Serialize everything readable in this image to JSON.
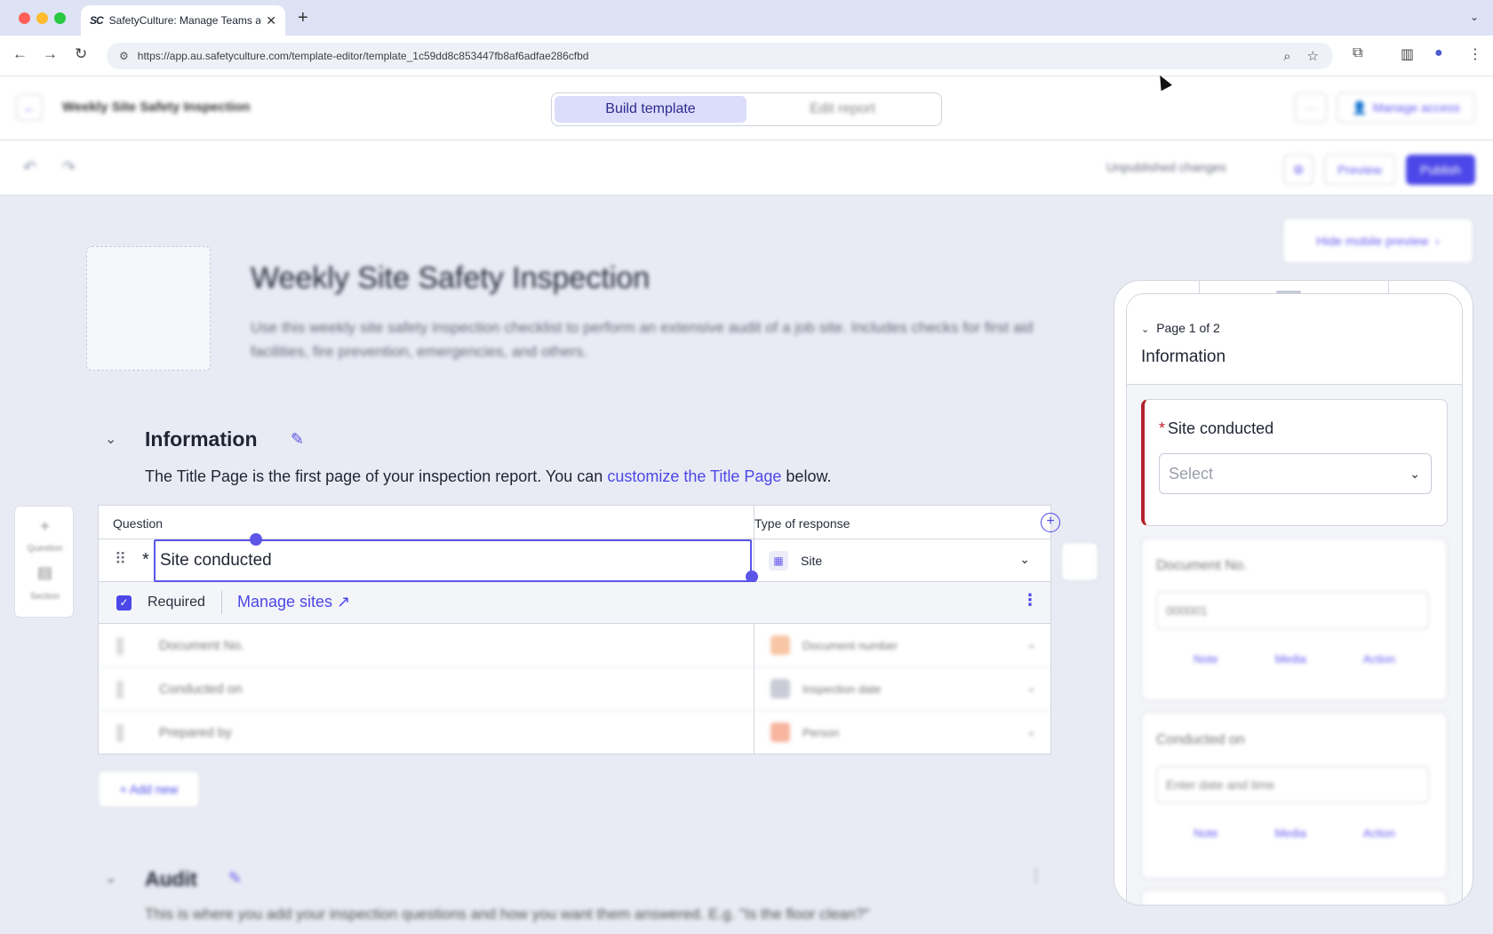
{
  "browser": {
    "tab_title": "SafetyCulture: Manage Teams and...",
    "tab_favicon": "SC",
    "url": "https://app.au.safetyculture.com/template-editor/template_1c59dd8c853447fb8af6adfae286cfbd"
  },
  "header": {
    "template_title": "Weekly Site Safety Inspection",
    "build_tab": "Build template",
    "edit_tab": "Edit report",
    "more_label": "···",
    "manage_access": "Manage access"
  },
  "toolbar": {
    "unpublished": "Unpublished changes",
    "preview": "Preview",
    "publish": "Publish"
  },
  "document": {
    "title": "Weekly Site Safety Inspection",
    "description": "Use this weekly site safety inspection checklist to perform an extensive audit of a job site. Includes checks for first aid facilities, fire prevention, emergencies, and others."
  },
  "section": {
    "title": "Information",
    "desc_before": "The Title Page is the first page of your inspection report. You can ",
    "desc_link": "customize the Title Page",
    "desc_after": " below."
  },
  "side_tools": {
    "question": "Question",
    "section": "Section"
  },
  "table": {
    "col_question": "Question",
    "col_type": "Type of response",
    "active_question": "Site conducted",
    "active_type": "Site",
    "required_label": "Required",
    "manage_sites": "Manage sites",
    "rows": [
      {
        "question": "Document No.",
        "type": "Document number",
        "icon_color": "#f7c6a5"
      },
      {
        "question": "Conducted on",
        "type": "Inspection date",
        "icon_color": "#c9ccd6"
      },
      {
        "question": "Prepared by",
        "type": "Person",
        "icon_color": "#f7b5a0"
      }
    ]
  },
  "add_new": "+ Add new",
  "audit": {
    "title": "Audit",
    "description": "This is where you add your inspection questions and how you want them answered. E.g. \"Is the floor clean?\""
  },
  "mobile": {
    "hide_preview": "Hide mobile preview",
    "page_indicator": "Page 1 of 2",
    "page_title": "Information",
    "q1_label": "Site conducted",
    "q1_placeholder": "Select",
    "q2_label": "Document No.",
    "q2_value": "000001",
    "q3_label": "Conducted on",
    "q3_placeholder": "Enter date and time",
    "note": "Note",
    "media": "Media",
    "action": "Action"
  },
  "colors": {
    "accent": "#4b47e8",
    "required_bar": "#b3242f"
  }
}
